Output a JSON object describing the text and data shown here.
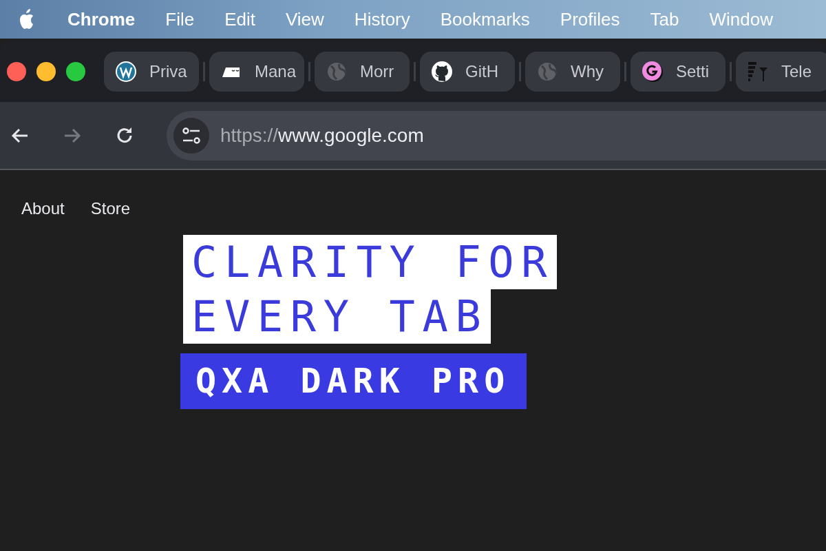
{
  "menu_bar": {
    "app_name": "Chrome",
    "items": [
      "File",
      "Edit",
      "View",
      "History",
      "Bookmarks",
      "Profiles",
      "Tab",
      "Window"
    ]
  },
  "tabs": [
    {
      "kind": "wordpress",
      "title": "Priva"
    },
    {
      "kind": "sign",
      "title": "Mana"
    },
    {
      "kind": "globe",
      "title": "Morr"
    },
    {
      "kind": "github",
      "title": "GitH"
    },
    {
      "kind": "globe",
      "title": "Why"
    },
    {
      "kind": "letter-g",
      "title": "Setti"
    },
    {
      "kind": "bars",
      "title": "Tele"
    }
  ],
  "toolbar": {
    "back": {
      "disabled": false
    },
    "forward": {
      "disabled": true
    },
    "reload": {
      "disabled": false
    },
    "address": {
      "scheme": "https://",
      "host": "www.google.com"
    }
  },
  "page": {
    "nav_links": [
      "About",
      "Store"
    ],
    "headline_lines": [
      "CLARITY FOR",
      "EVERY TAB"
    ],
    "subtitle": "QXA DARK PRO"
  }
}
